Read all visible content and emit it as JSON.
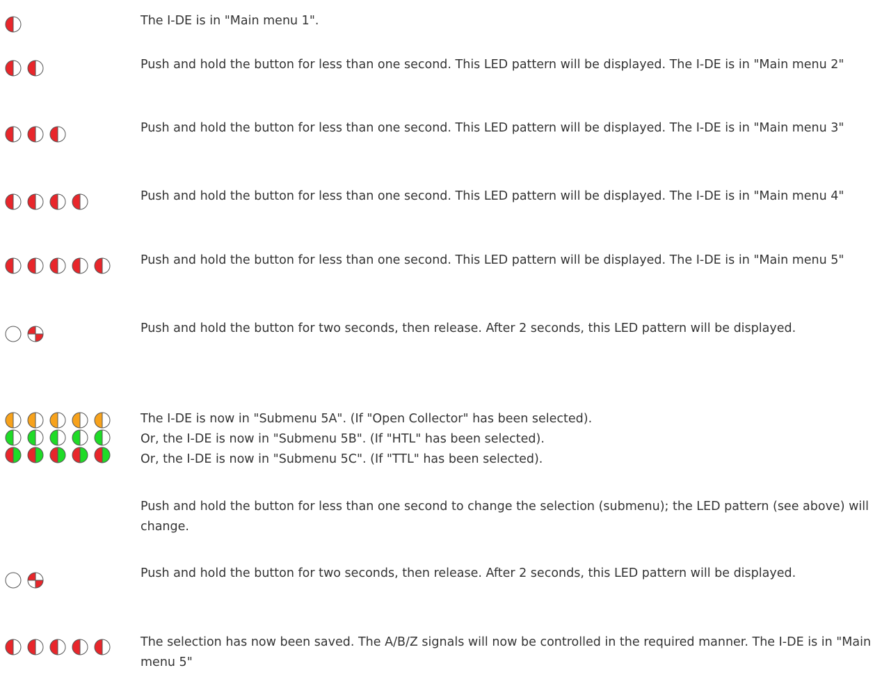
{
  "colors": {
    "red": "#e8262b",
    "orange": "#f7a21c",
    "green": "#1fdb27",
    "off": "#ffffff",
    "outline": "#555555"
  },
  "steps": [
    {
      "leds": [
        [
          "half-red"
        ]
      ],
      "lines": [
        "The I-DE is in \"Main menu 1\"."
      ]
    },
    {
      "leds": [
        [
          "half-red",
          "half-red"
        ]
      ],
      "lines": [
        "Push and hold the button for less than one second. This LED pattern will be displayed. The I-DE is in \"Main menu 2\""
      ]
    },
    {
      "leds": [
        [
          "half-red",
          "half-red",
          "half-red"
        ]
      ],
      "lines": [
        "Push and hold the button for less than one second. This LED pattern will be displayed. The I-DE is in \"Main menu 3\""
      ]
    },
    {
      "leds": [
        [
          "half-red",
          "half-red",
          "half-red",
          "half-red"
        ]
      ],
      "lines": [
        "Push and hold the button for less than one second. This LED pattern will be displayed. The I-DE is in \"Main menu 4\""
      ]
    },
    {
      "leds": [
        [
          "half-red",
          "half-red",
          "half-red",
          "half-red",
          "half-red"
        ]
      ],
      "lines": [
        "Push and hold the button for less than one second. This LED pattern will be displayed. The I-DE is in \"Main menu 5\""
      ]
    },
    {
      "leds": [
        [
          "off",
          "quarter-red"
        ]
      ],
      "lines": [
        "Push and hold the button for two seconds, then release. After 2 seconds, this LED pattern will be displayed."
      ]
    },
    {
      "leds": [
        [
          "half-orange",
          "half-orange",
          "half-orange",
          "half-orange",
          "half-orange"
        ],
        [
          "half-green",
          "half-green",
          "half-green",
          "half-green",
          "half-green"
        ],
        [
          "red-green",
          "red-green",
          "red-green",
          "red-green",
          "red-green"
        ]
      ],
      "lines": [
        "The I-DE is now in \"Submenu 5A\". (If \"Open Collector\" has been selected).",
        "Or, the I-DE is now in \"Submenu 5B\". (If \"HTL\" has been selected).",
        "Or, the I-DE is now in \"Submenu 5C\". (If \"TTL\" has been selected)."
      ]
    },
    {
      "leds": [],
      "lines": [
        "Push and hold the button for less than one second to change the selection (submenu); the LED pattern (see above) will change."
      ]
    },
    {
      "leds": [
        [
          "off",
          "quarter-red"
        ]
      ],
      "lines": [
        "Push and hold the button for two seconds, then release. After 2 seconds, this LED pattern will be displayed."
      ]
    },
    {
      "leds": [
        [
          "half-red",
          "half-red",
          "half-red",
          "half-red",
          "half-red"
        ]
      ],
      "lines": [
        "The selection has now been saved. The A/B/Z signals will now be controlled in the required manner. The I-DE is in \"Main menu 5\""
      ]
    }
  ]
}
